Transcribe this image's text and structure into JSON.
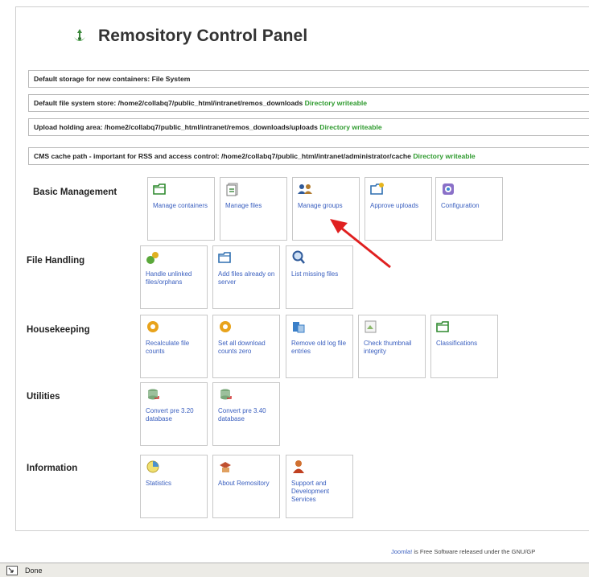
{
  "panel": {
    "title": "Remository Control Panel"
  },
  "info_rows": [
    {
      "label": "Default storage for new containers: File System",
      "status": ""
    },
    {
      "label": "Default file system store: /home2/collabq7/public_html/intranet/remos_downloads",
      "status": "Directory writeable"
    },
    {
      "label": "Upload holding area: /home2/collabq7/public_html/intranet/remos_downloads/uploads",
      "status": "Directory writeable"
    },
    {
      "label": "CMS cache path - important for RSS and access control: /home2/collabq7/public_html/intranet/administrator/cache",
      "status": "Directory writeable"
    }
  ],
  "sections": [
    {
      "label": "Basic Management",
      "tiles": [
        {
          "label": "Manage containers",
          "icon": "folder-icon"
        },
        {
          "label": "Manage files",
          "icon": "files-icon"
        },
        {
          "label": "Manage groups",
          "icon": "group-icon"
        },
        {
          "label": "Approve uploads",
          "icon": "approve-folder-icon"
        },
        {
          "label": "Configuration",
          "icon": "configuration-icon"
        }
      ]
    },
    {
      "label": "File Handling",
      "tiles": [
        {
          "label": "Handle unlinked files/orphans",
          "icon": "unlinked-files-icon"
        },
        {
          "label": "Add files already on server",
          "icon": "add-folder-icon"
        },
        {
          "label": "List missing files",
          "icon": "search-icon"
        }
      ]
    },
    {
      "label": "Housekeeping",
      "tiles": [
        {
          "label": "Recalculate file counts",
          "icon": "recalc-icon"
        },
        {
          "label": "Set all download counts zero",
          "icon": "reset-counts-icon"
        },
        {
          "label": "Remove old log file entries",
          "icon": "log-icon"
        },
        {
          "label": "Check thumbnail integrity",
          "icon": "thumbnail-icon"
        },
        {
          "label": "Classifications",
          "icon": "classifications-icon"
        }
      ]
    },
    {
      "label": "Utilities",
      "tiles": [
        {
          "label": "Convert pre 3.20 database",
          "icon": "database-convert-icon"
        },
        {
          "label": "Convert pre 3.40 database",
          "icon": "database-convert-icon"
        }
      ]
    },
    {
      "label": "Information",
      "tiles": [
        {
          "label": "Statistics",
          "icon": "statistics-icon"
        },
        {
          "label": "About Remository",
          "icon": "about-icon"
        },
        {
          "label": "Support and Development Services",
          "icon": "support-icon"
        }
      ]
    }
  ],
  "footer": {
    "link": "Joomla!",
    "text": " is Free Software released under the GNU/GP"
  },
  "statusbar": {
    "text": "Done"
  },
  "colors": {
    "link": "#3a5fbf",
    "ok": "#2e9a2e",
    "arrow": "#e02020"
  }
}
